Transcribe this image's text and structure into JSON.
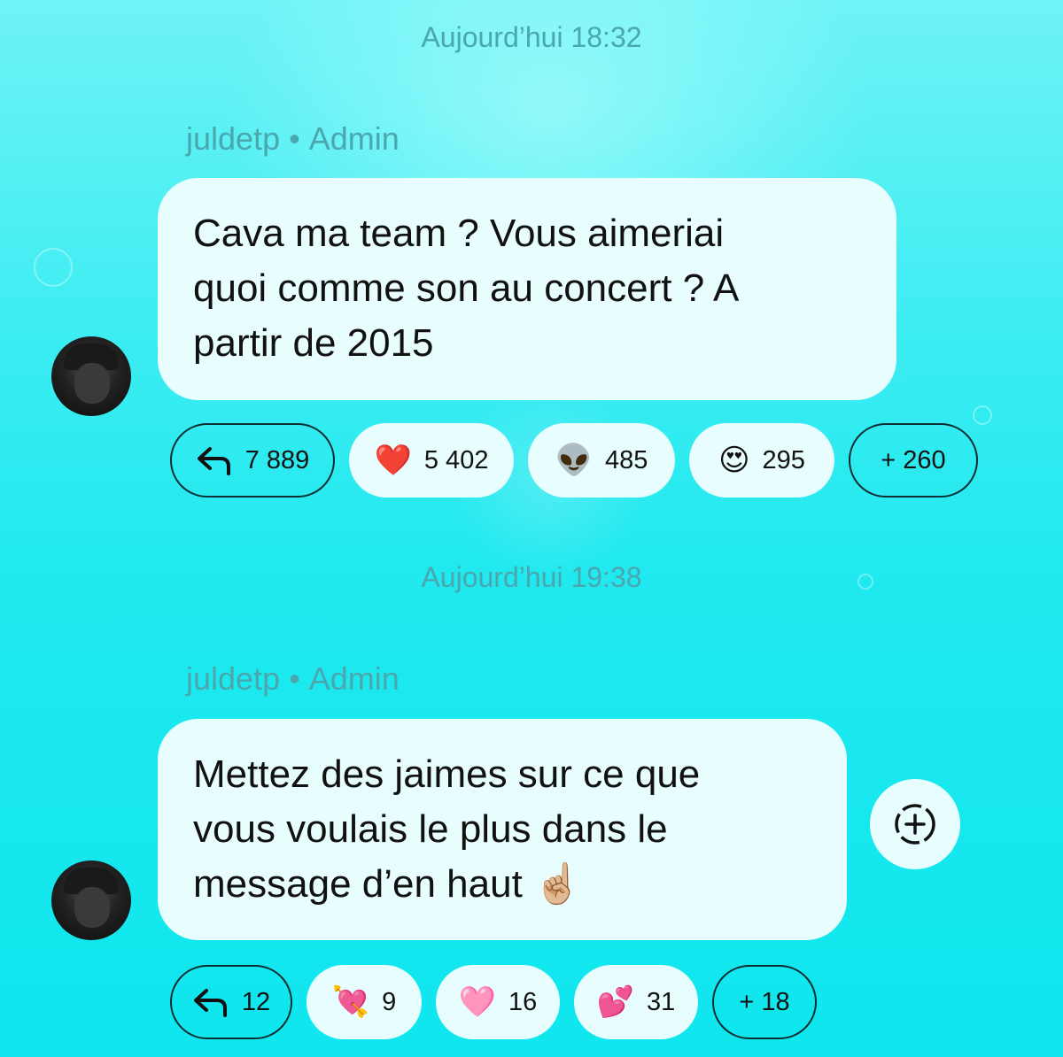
{
  "colors": {
    "background": "#1fe9ef",
    "bubble": "#e8fdfe",
    "meta_text": "#4aa7ad",
    "outline": "#0d2f33"
  },
  "messages": [
    {
      "timestamp": "Aujourd’hui 18:32",
      "sender": "juldetp",
      "role": "Admin",
      "separator": "•",
      "lines": [
        "Cava ma team ? Vous aimeriai",
        "quoi comme son au concert ? A",
        "partir de 2015"
      ],
      "reactions": [
        {
          "icon": "reply-arrow-icon",
          "count": "7 889"
        },
        {
          "icon": "red-heart-emoji",
          "emoji": "❤️",
          "count": "5 402"
        },
        {
          "icon": "alien-emoji",
          "emoji": "👽",
          "count": "485"
        },
        {
          "icon": "heart-eyes-emoji",
          "emoji": "😍",
          "count": "295"
        },
        {
          "icon": "more-reactions",
          "count": "+ 260"
        }
      ]
    },
    {
      "timestamp": "Aujourd’hui 19:38",
      "sender": "juldetp",
      "role": "Admin",
      "separator": "•",
      "lines": [
        "Mettez des jaimes sur ce que",
        "vous voulais le plus dans le",
        "message d’en haut ☝🏼"
      ],
      "reactions": [
        {
          "icon": "reply-arrow-icon",
          "count": "12"
        },
        {
          "icon": "heart-with-arrow-emoji",
          "emoji": "💘",
          "count": "9"
        },
        {
          "icon": "pink-heart-emoji",
          "emoji": "🩷",
          "count": "16"
        },
        {
          "icon": "two-hearts-emoji",
          "emoji": "💕",
          "count": "31"
        },
        {
          "icon": "more-reactions",
          "count": "+ 18"
        }
      ]
    }
  ],
  "add_reaction_icon": "add-reaction-icon"
}
